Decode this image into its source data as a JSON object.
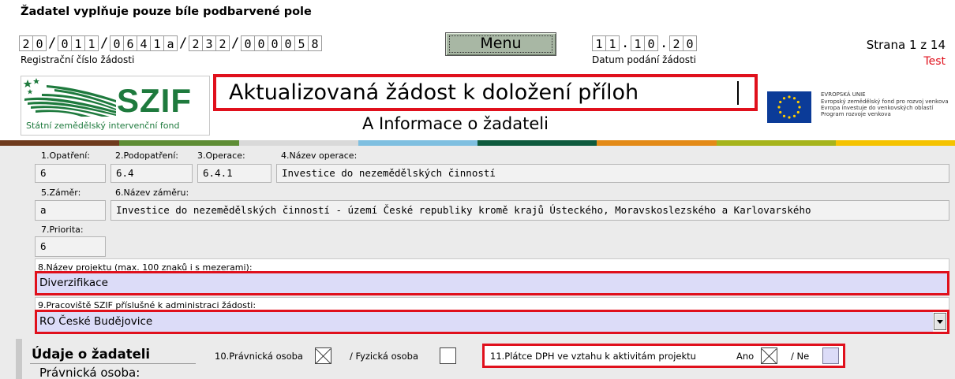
{
  "header": {
    "instruction": "Žadatel vyplňuje pouze bíle podbarvené pole",
    "reg_number": {
      "groups": [
        [
          "2",
          "0"
        ],
        [
          "0",
          "1",
          "1"
        ],
        [
          "0",
          "6",
          "4",
          "1",
          "a"
        ],
        [
          "2",
          "3",
          "2"
        ],
        [
          "0",
          "0",
          "0",
          "0",
          "5",
          "8"
        ]
      ],
      "separator": "/"
    },
    "reg_label": "Registrační číslo žádosti",
    "menu_label": "Menu",
    "date": {
      "groups": [
        [
          "1",
          "1"
        ],
        [
          "1",
          "0"
        ],
        [
          "2",
          "0"
        ]
      ],
      "separator": "."
    },
    "date_label": "Datum podání žádosti",
    "page_info": "Strana 1 z 14",
    "test_label": "Test"
  },
  "logo": {
    "name": "SZIF",
    "subtitle": "Státní zemědělský intervenční fond"
  },
  "form_title": "Aktualizovaná žádost k doložení příloh",
  "section_subtitle": "A Informace o žadateli",
  "eu_logo": {
    "lines": [
      "EVROPSKÁ UNIE",
      "Evropský zemědělský fond pro rozvoj venkova",
      "Evropa investuje do venkovských oblastí",
      "Program rozvoje venkova"
    ]
  },
  "color_band": [
    "#6f3b1e",
    "#5e8d35",
    "#d9d9d9",
    "#7fbfe0",
    "#0e5a3d",
    "#e38a17",
    "#a6b41c",
    "#f5c300"
  ],
  "fields": {
    "opatreni": {
      "label": "1.Opatření:",
      "value": "6"
    },
    "podopatreni": {
      "label": "2.Podopatření:",
      "value": "6.4"
    },
    "operace": {
      "label": "3.Operace:",
      "value": "6.4.1"
    },
    "nazev_operace": {
      "label": "4.Název operace:",
      "value": "Investice do nezemědělských činností"
    },
    "zamer": {
      "label": "5.Záměr:",
      "value": "a"
    },
    "nazev_zameru": {
      "label": "6.Název záměru:",
      "value": "Investice do nezemědělských činností - území České republiky kromě krajů Ústeckého, Moravskoslezského a Karlovarského"
    },
    "priorita": {
      "label": "7.Priorita:",
      "value": "6"
    },
    "nazev_projektu": {
      "label": "8.Název projektu (max. 100 znaků i s mezerami):",
      "value": "Diverzifikace"
    },
    "pracoviste": {
      "label": "9.Pracoviště SZIF příslušné k administraci žádosti:",
      "value": "RO České Budějovice"
    }
  },
  "applicant": {
    "heading": "Údaje o žadateli",
    "pravnicka_label": "10.Právnická osoba",
    "fyzicka_label": "/ Fyzická osoba",
    "pravnicka_checked": true,
    "fyzicka_checked": false,
    "dph_label": "11.Plátce DPH ve vztahu k aktivitám projektu",
    "ano_label": "Ano",
    "ne_label": "/ Ne",
    "ano_checked": true,
    "ne_checked": false,
    "subheading": "Právnická osoba:"
  }
}
